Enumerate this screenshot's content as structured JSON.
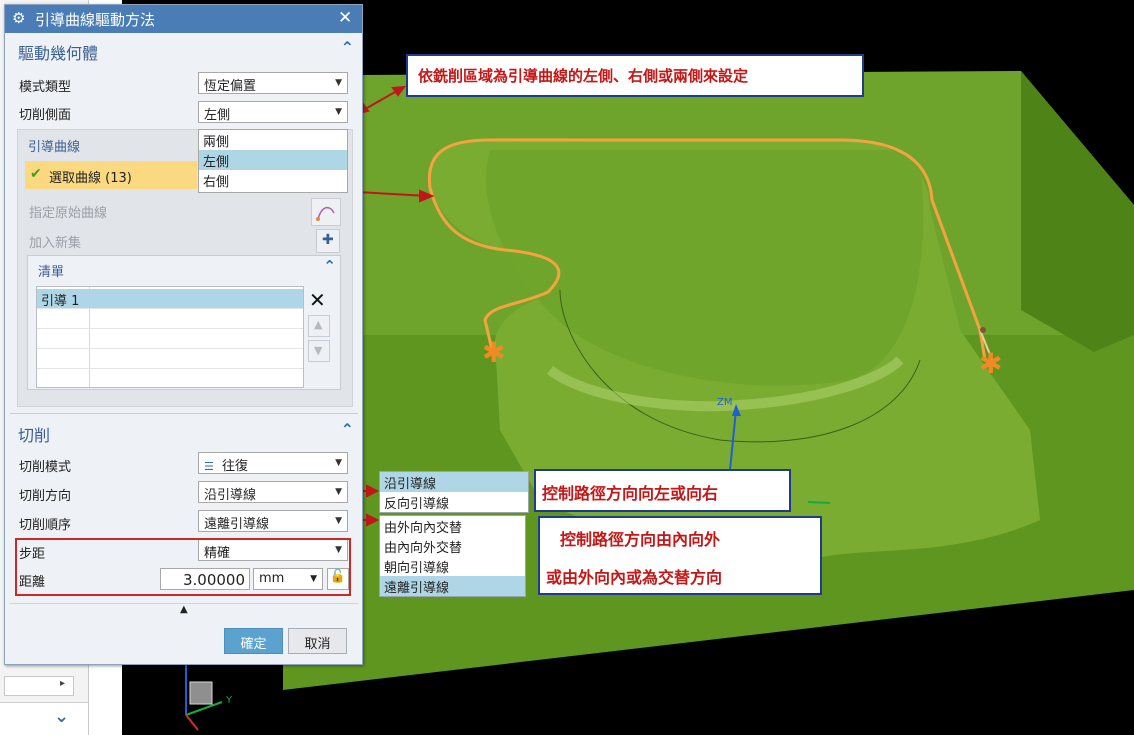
{
  "dialog": {
    "title": "引導曲線驅動方法",
    "drive_geometry": {
      "header": "驅動幾何體",
      "pattern_type_label": "模式類型",
      "pattern_type_value": "恆定偏置",
      "cut_side_label": "切削側面",
      "cut_side_value": "左側",
      "cut_side_options": [
        "兩側",
        "左側",
        "右側"
      ],
      "guide_curves_header": "引導曲線",
      "select_curve_label": "選取曲線 (13)",
      "specify_origin_label": "指定原始曲線",
      "add_new_set_label": "加入新集",
      "list_header": "清單",
      "list_rows": [
        "引導 1",
        "",
        "",
        "",
        ""
      ]
    },
    "cut": {
      "header": "切削",
      "cut_pattern_label": "切削模式",
      "cut_pattern_value": "往復",
      "cut_direction_label": "切削方向",
      "cut_direction_value": "沿引導線",
      "cut_order_label": "切削順序",
      "cut_order_value": "遠離引導線",
      "stepover_label": "步距",
      "stepover_value": "精確",
      "distance_label": "距離",
      "distance_value": "3.00000",
      "distance_unit": "mm"
    },
    "ok_label": "確定",
    "cancel_label": "取消"
  },
  "direction_options": [
    "沿引導線",
    "反向引導線"
  ],
  "order_options": [
    "由外向內交替",
    "由內向外交替",
    "朝向引導線",
    "遠離引導線"
  ],
  "callouts": {
    "top": "依銑削區域為引導曲線的左側、右側或兩側來設定",
    "direction": "控制路徑方向向左或向右",
    "order_line1": "控制路徑方向由內向外",
    "order_line2": "或由外向內或為交替方向"
  },
  "viewport": {
    "axis_label_zm": "ZM",
    "triad_y_label": "Y"
  },
  "icons": [
    "gear-icon",
    "close-icon",
    "chevron-up-icon",
    "checkmark-icon",
    "curve-icon",
    "add-set-icon",
    "delete-x-icon",
    "move-up-icon",
    "move-down-icon",
    "lock-icon",
    "chevron-down-icon"
  ],
  "colors": {
    "model_green": "#5e9c22",
    "guide_curve": "#f4a340",
    "callout_text": "#c41717",
    "title_bar": "#4a7cb6",
    "selection": "#aed6e6"
  }
}
